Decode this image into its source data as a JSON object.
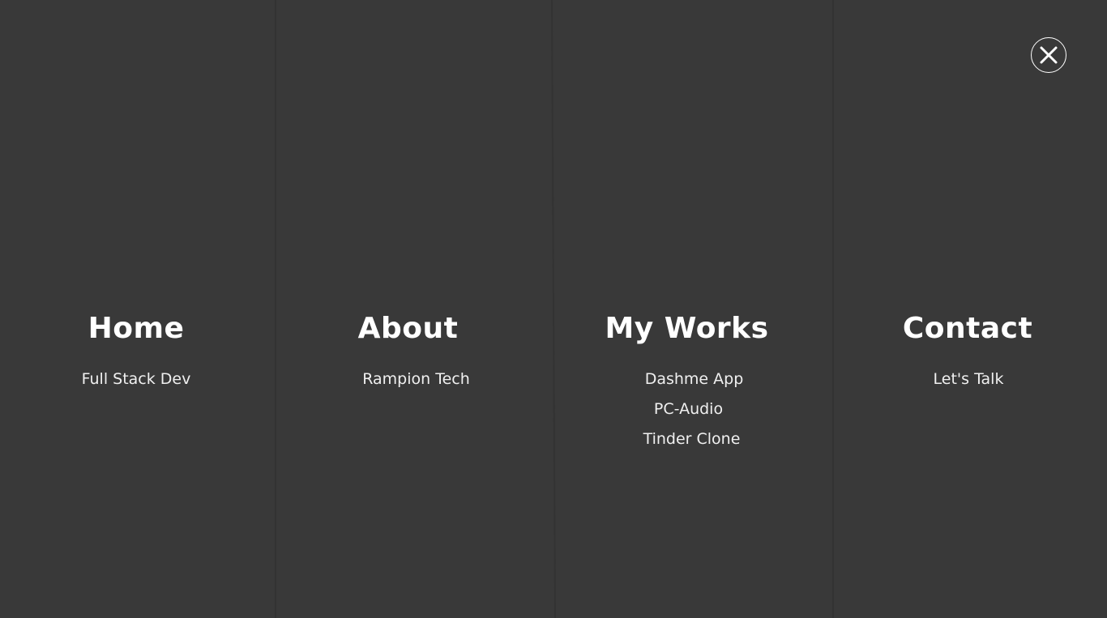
{
  "menu": {
    "columns": [
      {
        "heading": "Home",
        "links": [
          "Full Stack Dev"
        ]
      },
      {
        "heading": "About",
        "links": [
          "Rampion Tech"
        ]
      },
      {
        "heading": "My Works",
        "links": [
          "Dashme App",
          "PC-Audio",
          "Tinder Clone"
        ]
      },
      {
        "heading": "Contact",
        "links": [
          "Let's Talk"
        ]
      }
    ]
  },
  "close": {
    "icon": "close-icon"
  },
  "colors": {
    "background": "#393939",
    "text": "#ffffff",
    "divider": "#333333"
  }
}
